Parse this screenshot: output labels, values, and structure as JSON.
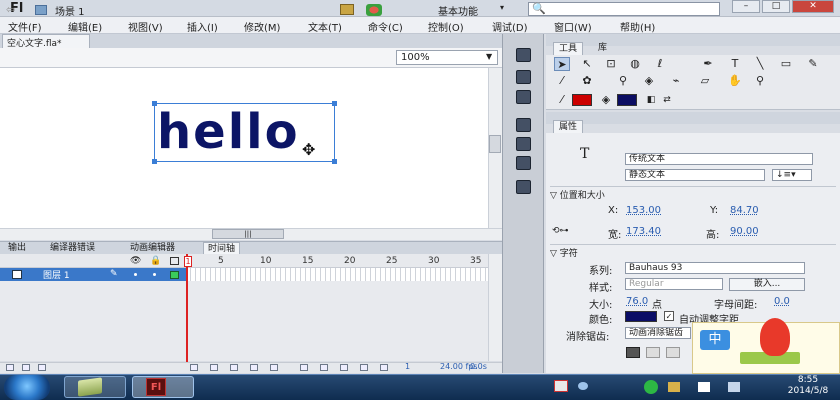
{
  "app": {
    "logo": "Fl",
    "workspace": "基本功能",
    "search_icon": "🔍"
  },
  "window_buttons": {
    "minimize": "–",
    "maximize": "□",
    "close": "✕"
  },
  "menu": [
    "文件(F)",
    "编辑(E)",
    "视图(V)",
    "插入(I)",
    "修改(M)",
    "文本(T)",
    "命令(C)",
    "控制(O)",
    "调试(D)",
    "窗口(W)",
    "帮助(H)"
  ],
  "document": {
    "tab": "空心文字.fla*",
    "scene": "场景 1",
    "zoom": "100%"
  },
  "stage": {
    "text": "hello"
  },
  "panel_tabs": [
    "输出",
    "编译器错误",
    "动画编辑器",
    "时间轴"
  ],
  "timeline": {
    "layer_name": "图层 1",
    "ruler": [
      "1",
      "5",
      "10",
      "15",
      "20",
      "25",
      "30",
      "35"
    ],
    "current_frame": "1",
    "fps": "24.00 fps",
    "time": "0.0s"
  },
  "tools_panel": {
    "tab_tools": "工具",
    "tab_library": "库",
    "stroke_color": "#cc0000",
    "fill_color": "#0b0d62"
  },
  "properties": {
    "tab": "属性",
    "text_icon": "T",
    "text_engine": "传统文本",
    "text_type": "静态文本",
    "section_position": "位置和大小",
    "x_label": "X:",
    "x_value": "153.00",
    "y_label": "Y:",
    "y_value": "84.70",
    "w_label": "宽:",
    "w_value": "173.40",
    "h_label": "高:",
    "h_value": "90.00",
    "section_char": "字符",
    "family_label": "系列:",
    "family_value": "Bauhaus 93",
    "style_label": "样式:",
    "style_value": "Regular",
    "embed_button": "嵌入...",
    "size_label": "大小:",
    "size_value": "76.0",
    "size_unit": "点",
    "spacing_label": "字母间距:",
    "spacing_value": "0.0",
    "color_label": "颜色:",
    "color_value": "#0a0d66",
    "autokern_label": "自动调整字距",
    "antialias_label": "消除锯齿:",
    "antialias_value": "动画消除锯齿"
  },
  "ime": {
    "badge": "中"
  },
  "clock": {
    "time": "8:55",
    "date": "2014/5/8"
  }
}
